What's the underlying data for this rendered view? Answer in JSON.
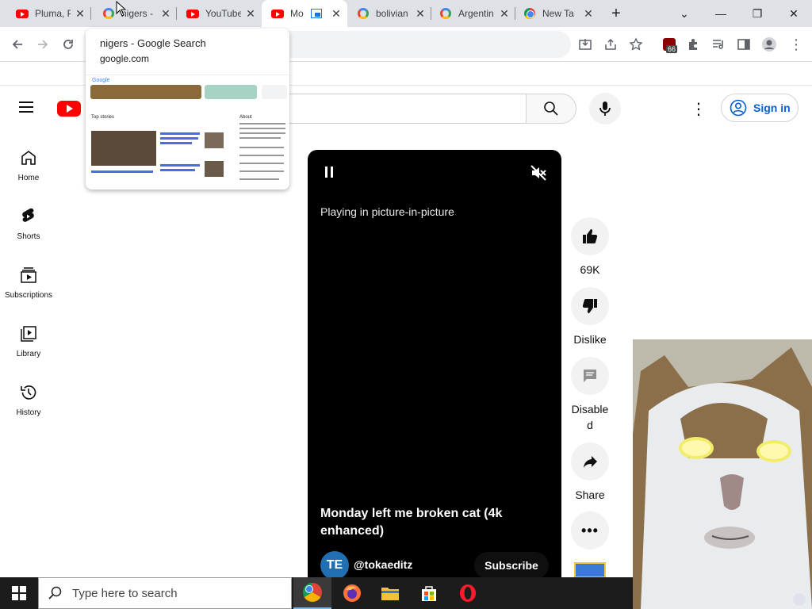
{
  "browser": {
    "tabs": [
      {
        "title": "Pluma, P",
        "favicon": "youtube-favicon",
        "active": false
      },
      {
        "title": "nigers -",
        "favicon": "google-favicon",
        "active": false
      },
      {
        "title": "YouTube",
        "favicon": "youtube-favicon",
        "active": false
      },
      {
        "title": "Mo",
        "favicon": "youtube-favicon",
        "active": true
      },
      {
        "title": "bolivian",
        "favicon": "google-favicon",
        "active": false
      },
      {
        "title": "Argentin",
        "favicon": "google-favicon",
        "active": false
      },
      {
        "title": "New Ta",
        "favicon": "chrome-favicon",
        "active": false
      }
    ],
    "tab_close_glyph": "✕",
    "new_tab_glyph": "+",
    "window_controls": {
      "tab_search": "⌄",
      "minimize": "—",
      "restore": "❐",
      "close": "✕"
    },
    "extension_badge": "66",
    "hover_card": {
      "title": "nigers - Google Search",
      "url": "google.com",
      "thumb_logo": "Google",
      "thumb_stories_heading": "Top stories",
      "thumb_about": "About"
    }
  },
  "youtube": {
    "sign_in_label": "Sign in",
    "guide": [
      {
        "label": "Home",
        "icon": "home-icon"
      },
      {
        "label": "Shorts",
        "icon": "shorts-icon"
      },
      {
        "label": "Subscriptions",
        "icon": "subscriptions-icon"
      },
      {
        "label": "Library",
        "icon": "library-icon"
      },
      {
        "label": "History",
        "icon": "history-icon"
      }
    ],
    "player": {
      "status_text": "Playing in picture-in-picture",
      "title": "Monday left me broken cat (4k enhanced)",
      "channel_name": "@tokaeditz",
      "channel_avatar_text": "TE",
      "subscribe_label": "Subscribe"
    },
    "actions": {
      "likes": "69K",
      "dislike_label": "Dislike",
      "comments_label_line1": "Disable",
      "comments_label_line2": "d",
      "share_label": "Share"
    }
  },
  "taskbar": {
    "search_placeholder": "Type here to search",
    "apps": [
      "chrome-icon",
      "firefox-icon",
      "file-explorer-icon",
      "microsoft-store-icon",
      "opera-icon"
    ]
  },
  "colors": {
    "youtube_red": "#ff0000",
    "link_blue": "#065fd4",
    "tabstrip": "#dee1e6",
    "taskbar": "#1c1c1c"
  }
}
